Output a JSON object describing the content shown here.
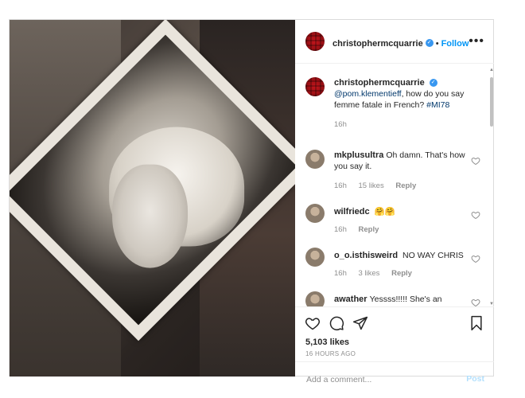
{
  "post": {
    "author": "christophermcquarrie",
    "follow_label": "Follow",
    "separator": "•",
    "more_label": "•••"
  },
  "caption": {
    "username": "christophermcquarrie",
    "mention": "@pom.klementieff",
    "text": ", how do you say femme fatale in French?",
    "hashtag": "#MI78",
    "time": "16h"
  },
  "comments": [
    {
      "username": "mkplusultra",
      "text": "Oh damn. That's how you say it.",
      "time": "16h",
      "likes": "15 likes",
      "reply": "Reply"
    },
    {
      "username": "wilfriedc",
      "text": "🤗🤗",
      "time": "16h",
      "likes": "",
      "reply": "Reply"
    },
    {
      "username": "o_o.isthisweird",
      "text": "NO WAY CHRIS",
      "time": "16h",
      "likes": "3 likes",
      "reply": "Reply"
    },
    {
      "username": "awather",
      "text": "Yessss!!!!! She's an",
      "time": "",
      "likes": "",
      "reply": ""
    }
  ],
  "actions": {
    "likes": "5,103 likes",
    "time_ago": "16 HOURS AGO"
  },
  "add_comment": {
    "placeholder": "Add a comment...",
    "post_label": "Post"
  },
  "colors": {
    "accent": "#0095f6",
    "verified": "#3897f0",
    "muted": "#8e8e8e",
    "text": "#262626",
    "border": "#dbdbdb"
  }
}
